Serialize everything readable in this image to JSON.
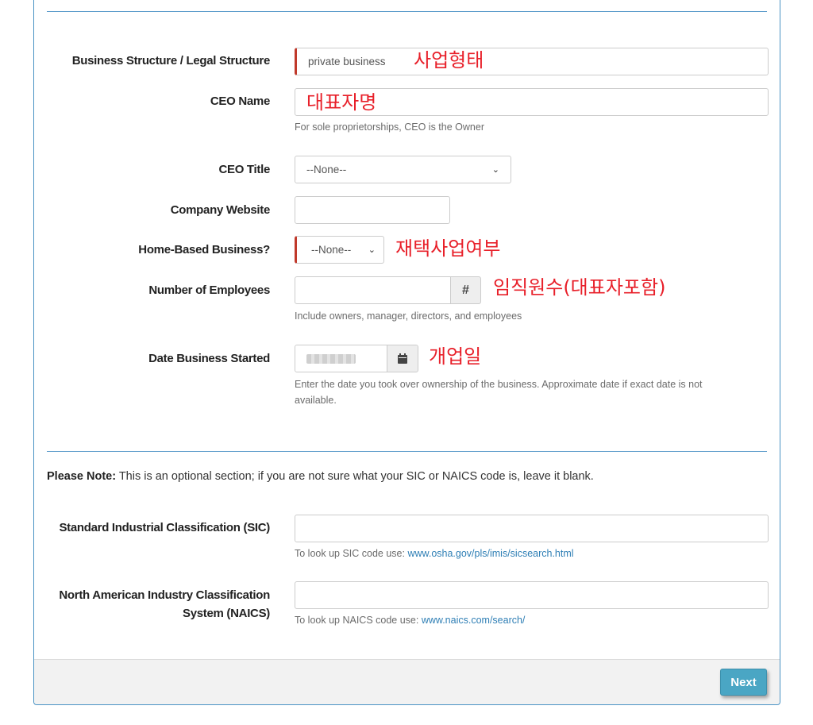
{
  "form": {
    "business_structure": {
      "label": "Business Structure / Legal Structure",
      "value": "private business",
      "annotation": "사업형태"
    },
    "ceo_name": {
      "label": "CEO Name",
      "annotation": "대표자명",
      "help": "For sole proprietorships, CEO is the Owner"
    },
    "ceo_title": {
      "label": "CEO Title",
      "value": "--None--"
    },
    "company_website": {
      "label": "Company Website",
      "value": ""
    },
    "home_based": {
      "label": "Home-Based Business?",
      "value": "--None--",
      "annotation": "재택사업여부"
    },
    "employees": {
      "label": "Number of Employees",
      "addon": "#",
      "annotation": "임직원수(대표자포함)",
      "help": "Include owners, manager, directors, and employees"
    },
    "date_started": {
      "label": "Date Business Started",
      "annotation": "개업일",
      "help_line1": "Enter the date you took over ownership of the business. Approximate date if exact date is not",
      "help_line2": "available."
    }
  },
  "note": {
    "prefix": "Please Note:",
    "text": " This is an optional section; if you are not sure what your SIC or NAICS code is, leave it blank."
  },
  "sic": {
    "label": "Standard Industrial Classification (SIC)",
    "help": "To look up SIC code use: ",
    "link": "www.osha.gov/pls/imis/sicsearch.html"
  },
  "naics": {
    "label_line1": "North American Industry Classification",
    "label_line2": "System (NAICS)",
    "help": "To look up NAICS code use: ",
    "link": "www.naics.com/search/"
  },
  "footer": {
    "next_label": "Next"
  },
  "colors": {
    "accent": "#4aa6c4",
    "annotation": "#e8202a",
    "required": "#c0392b",
    "divider": "#5d9ccb"
  }
}
